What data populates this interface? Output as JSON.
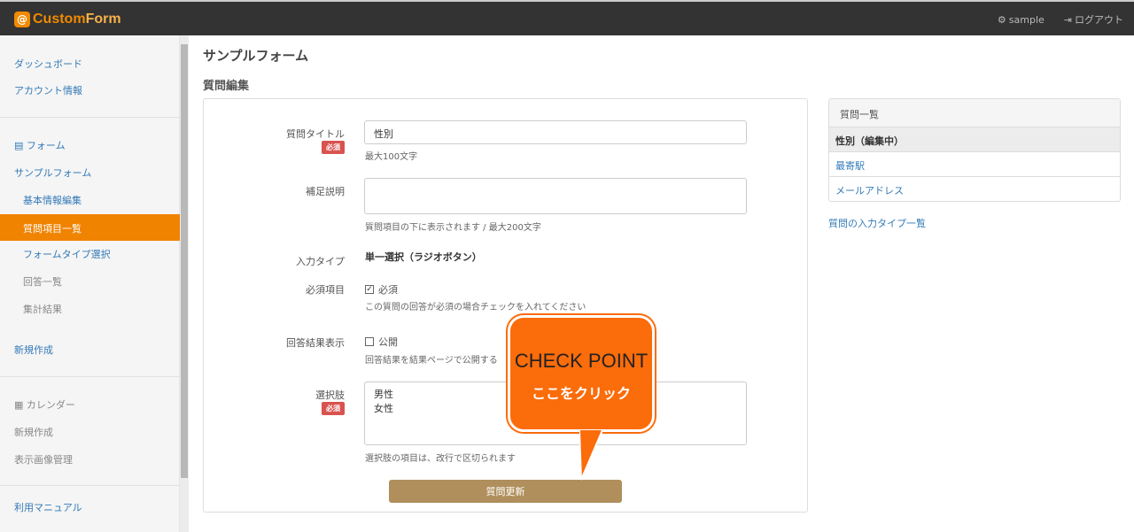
{
  "topbar": {
    "logo_badge": "@",
    "logo_custom": "Custom",
    "logo_form": "Form",
    "user_label": "sample",
    "logout_label": "ログアウト"
  },
  "sidebar": {
    "dashboard": "ダッシュボード",
    "account": "アカウント情報",
    "forms": "フォーム",
    "sample_form": "サンプルフォーム",
    "basic_info": "基本情報編集",
    "questions": "質問項目一覧",
    "form_type": "フォームタイプ選択",
    "answers": "回答一覧",
    "results": "集計結果",
    "new_create": "新規作成",
    "calendar": "カレンダー",
    "calendar_new": "新規作成",
    "image_manage": "表示画像管理",
    "manual": "利用マニュアル"
  },
  "main": {
    "page_title": "サンプルフォーム",
    "section_title": "質問編集"
  },
  "form": {
    "title_label": "質問タイトル",
    "required_badge": "必須",
    "title_value": "性別",
    "title_help": "最大100文字",
    "desc_label": "補足説明",
    "desc_value": "",
    "desc_help": "質問項目の下に表示されます / 最大200文字",
    "input_type_label": "入力タイプ",
    "input_type_value": "単一選択（ラジオボタン）",
    "required_label": "必須項目",
    "required_check": "必須",
    "required_checked": true,
    "required_help": "この質問の回答が必須の場合チェックを入れてください",
    "public_label": "回答結果表示",
    "public_check": "公開",
    "public_checked": false,
    "public_help": "回答結果を結果ページで公開する",
    "choices_label": "選択肢",
    "choices_value": "男性\n女性",
    "choices_help": "選択肢の項目は、改行で区切られます",
    "submit_label": "質問更新"
  },
  "question_list": {
    "header": "質問一覧",
    "items": [
      {
        "label": "性別（編集中）",
        "current": true
      },
      {
        "label": "最寄駅",
        "current": false
      },
      {
        "label": "メールアドレス",
        "current": false
      }
    ],
    "input_types_link": "質問の入力タイプ一覧"
  },
  "callout": {
    "title": "CHECK POINT",
    "subtitle": "ここをクリック"
  },
  "colors": {
    "accent": "#f08300",
    "submit": "#b08f5c",
    "callout": "#fb6c0a",
    "link": "#337ab7",
    "required": "#d9534f"
  }
}
